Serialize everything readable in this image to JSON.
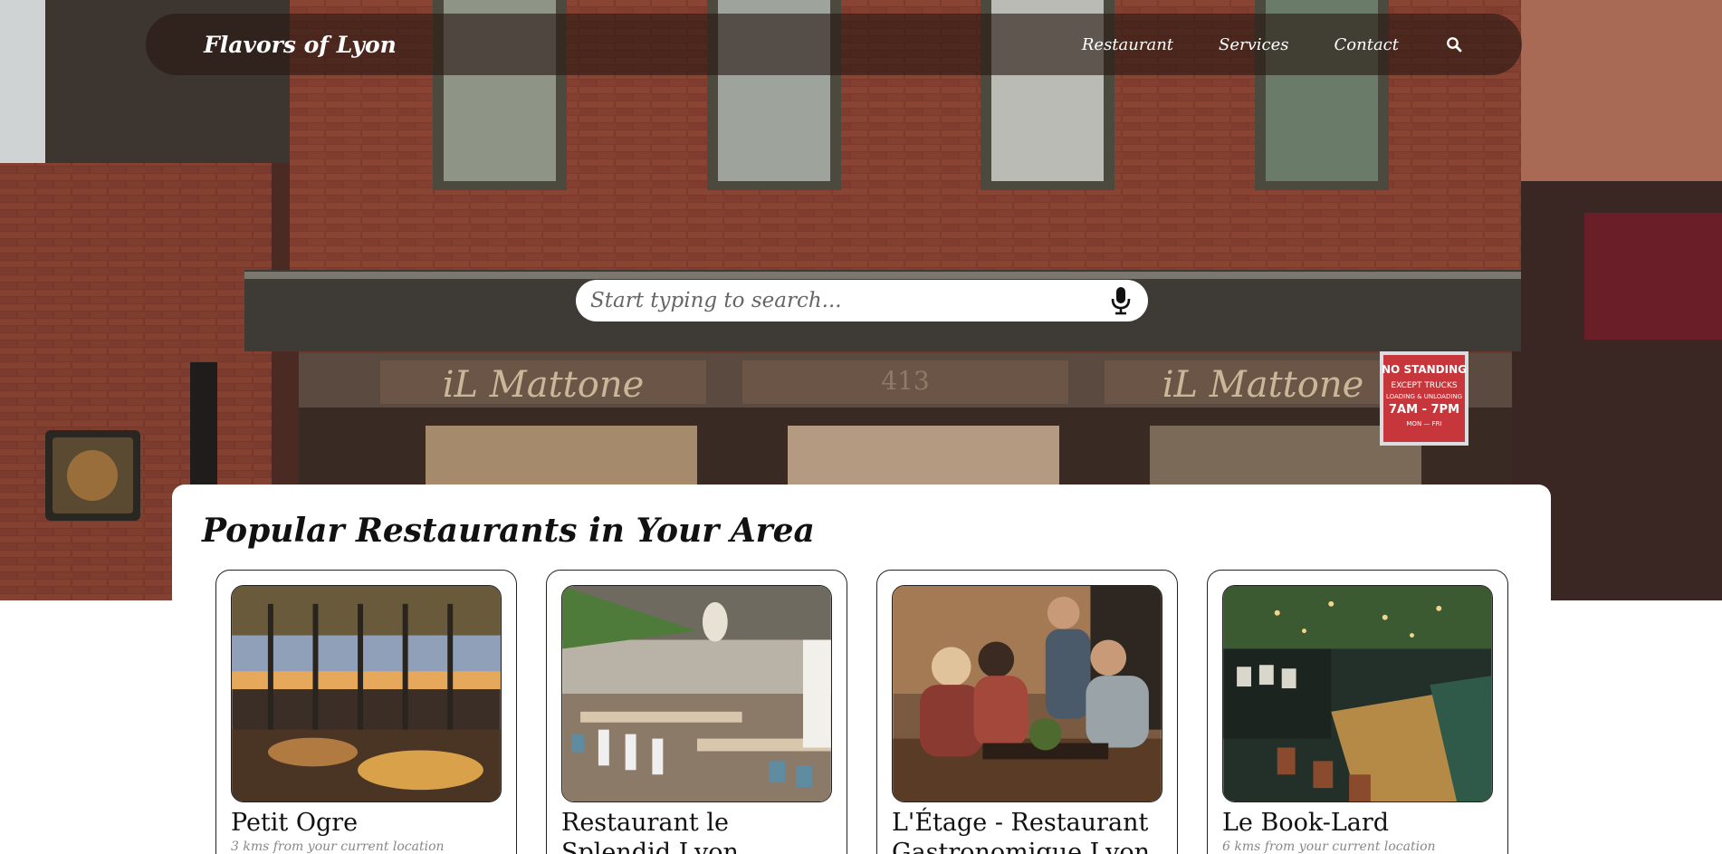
{
  "nav": {
    "brand": "Flavors of Lyon",
    "links": [
      "Restaurant",
      "Services",
      "Contact"
    ]
  },
  "hero": {
    "signs": {
      "left": "iL Mattone",
      "center": "413",
      "right": "iL Mattone"
    },
    "no_standing": [
      "NO STANDING",
      "EXCEPT TRUCKS",
      "LOADING & UNLOADING",
      "7AM - 7PM",
      "MON — FRI"
    ]
  },
  "search": {
    "placeholder": "Start typing to search..."
  },
  "main": {
    "title": "Popular Restaurants in Your Area",
    "restaurants": [
      {
        "name": "Petit Ogre",
        "distance": "3 kms from your current location"
      },
      {
        "name": "Restaurant le Splendid Lyon",
        "distance": ""
      },
      {
        "name": "L'Étage - Restaurant Gastronomique Lyon",
        "distance": ""
      },
      {
        "name": "Le Book-Lard",
        "distance": "6 kms from your current location"
      }
    ]
  },
  "colors": {
    "navbar_bg": "#28181466",
    "brick": "#7d3d2e",
    "panel_bg": "#ffffff"
  }
}
